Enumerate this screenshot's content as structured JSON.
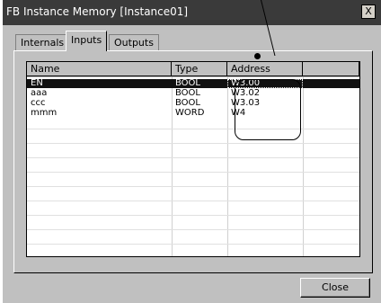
{
  "window": {
    "title": "FB Instance Memory [Instance01]",
    "close_glyph": "X"
  },
  "tabs": [
    {
      "label": "Internals",
      "active": false
    },
    {
      "label": "Inputs",
      "active": true
    },
    {
      "label": "Outputs",
      "active": false
    }
  ],
  "table": {
    "columns": [
      "Name",
      "Type",
      "Address",
      ""
    ],
    "rows": [
      {
        "name": "EN",
        "type": "BOOL",
        "address": "W3.00",
        "selected": true
      },
      {
        "name": "aaa",
        "type": "BOOL",
        "address": "W3.02",
        "selected": false
      },
      {
        "name": "ccc",
        "type": "BOOL",
        "address": "W3.03",
        "selected": false
      },
      {
        "name": "mmm",
        "type": "WORD",
        "address": "W4",
        "selected": false
      }
    ]
  },
  "footer": {
    "close_label": "Close"
  }
}
